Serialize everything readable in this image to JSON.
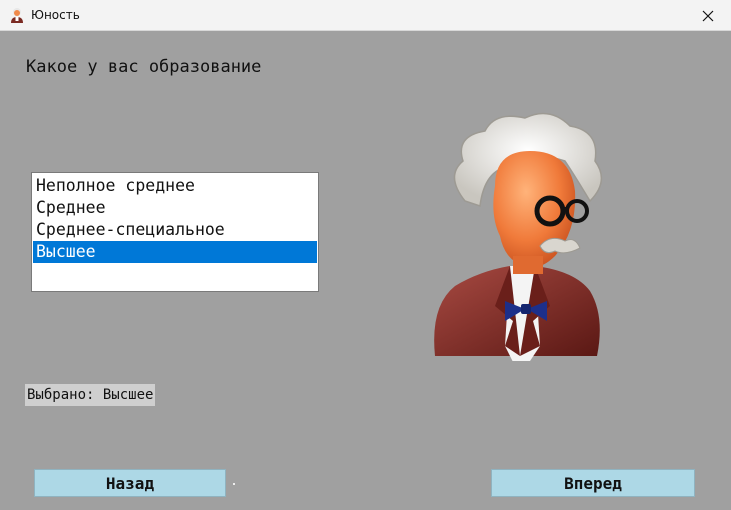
{
  "window": {
    "title": "Юность",
    "app_icon": "professor-icon",
    "close_icon": "close-icon"
  },
  "main": {
    "question": "Какое у вас образование",
    "education_list": {
      "items": [
        {
          "label": "Неполное среднее",
          "selected": false
        },
        {
          "label": "Среднее",
          "selected": false
        },
        {
          "label": "Среднее-специальное",
          "selected": false
        },
        {
          "label": "Высшее",
          "selected": true
        }
      ]
    },
    "selected_text": "Выбрано: Высшее",
    "avatar_icon": "professor-avatar"
  },
  "buttons": {
    "back_label": "Назад",
    "next_label": "Вперед"
  },
  "colors": {
    "background": "#a0a0a0",
    "selection": "#0078d7",
    "button": "#add8e6",
    "titlebar": "#f3f3f3"
  }
}
